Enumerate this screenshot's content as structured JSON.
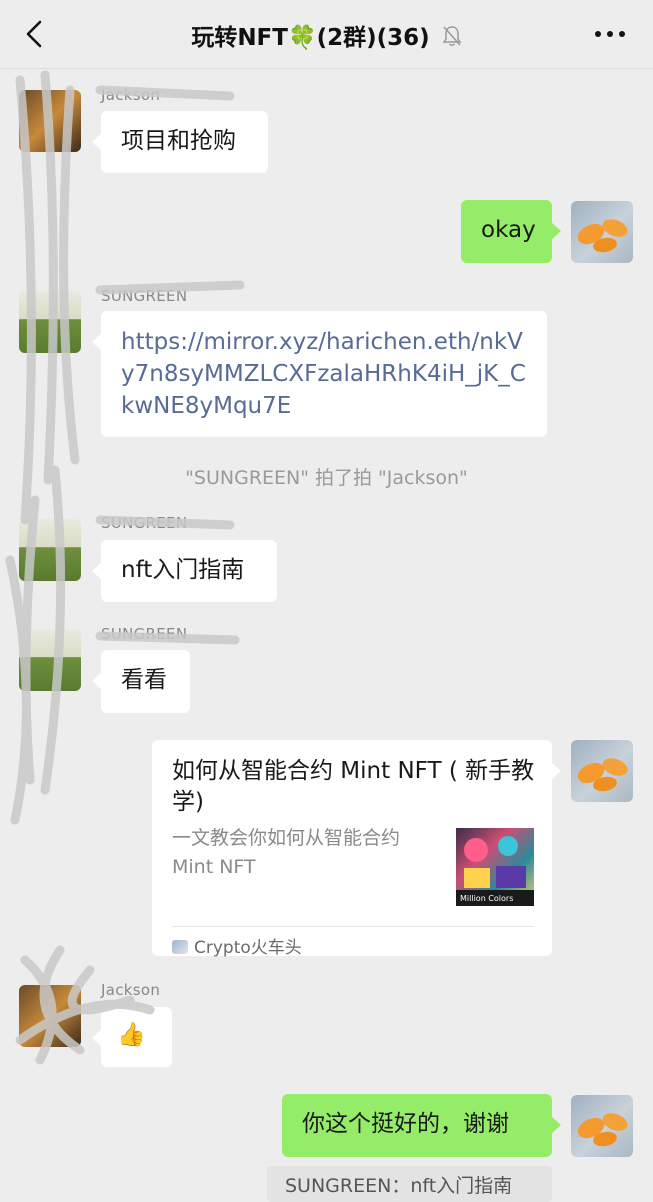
{
  "header": {
    "title": "玩转NFT🍀(2群)(36)",
    "back_icon": "chevron-left-icon",
    "mute_icon": "bell-off-icon",
    "more_icon": "more-dots-icon"
  },
  "messages": {
    "m1": {
      "sender": "Jackson",
      "text": "项目和抢购"
    },
    "m2": {
      "text": "okay"
    },
    "m3": {
      "sender": "SUNGREEN",
      "text": "https://mirror.xyz/harichen.eth/nkVy7n8syMMZLCXFzalaHRhK4iH_jK_CkwNE8yMqu7E"
    },
    "system1": "\"SUNGREEN\" 拍了拍 \"Jackson\"",
    "m4": {
      "sender": "SUNGREEN",
      "text": "nft入门指南"
    },
    "m5": {
      "sender": "SUNGREEN",
      "text": "看看"
    },
    "m6": {
      "title": "如何从智能合约 Mint NFT ( 新手教学)",
      "description": "一文教会你如何从智能合约 Mint NFT",
      "source": "Crypto火车头",
      "thumb_text": "Million Colors"
    },
    "m7": {
      "sender": "Jackson",
      "text": "👍"
    },
    "m8": {
      "text": "你这个挺好的，谢谢"
    },
    "quote": "SUNGREEN：nft入门指南"
  },
  "colors": {
    "background": "#ededed",
    "outgoing_bubble": "#95ec69",
    "incoming_bubble": "#ffffff",
    "link": "#576b95"
  }
}
